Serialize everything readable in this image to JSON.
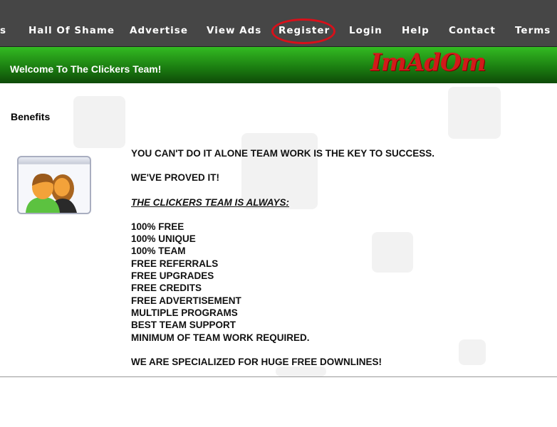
{
  "nav": {
    "items": [
      "s",
      "Hall Of Shame",
      "Advertise",
      "View Ads",
      "Register",
      "Login",
      "Help",
      "Contact",
      "Terms"
    ],
    "highlighted": "Register"
  },
  "banner": {
    "welcome": "Welcome To The Clickers Team!",
    "logo": "ImAdOm"
  },
  "colors": {
    "nav_bg": "#464646",
    "banner_green": "#2aa51c",
    "highlight_ring": "#d8101a",
    "logo": "#d21a1a"
  },
  "main": {
    "section_title": "Benefits",
    "icon": "team-users-icon",
    "intro": "YOU CAN'T DO IT ALONE TEAM WORK IS THE KEY TO SUCCESS.",
    "proved": "WE'VE PROVED IT!",
    "always": "THE CLICKERS TEAM IS ALWAYS:",
    "list": [
      "100% FREE",
      "100% UNIQUE",
      "100% TEAM",
      "FREE REFERRALS",
      "FREE UPGRADES",
      "FREE CREDITS",
      "FREE ADVERTISEMENT",
      "MULTIPLE PROGRAMS",
      "BEST TEAM SUPPORT",
      "MINIMUM OF TEAM WORK REQUIRED."
    ],
    "closing": "WE ARE SPECIALIZED FOR HUGE FREE DOWNLINES!"
  }
}
